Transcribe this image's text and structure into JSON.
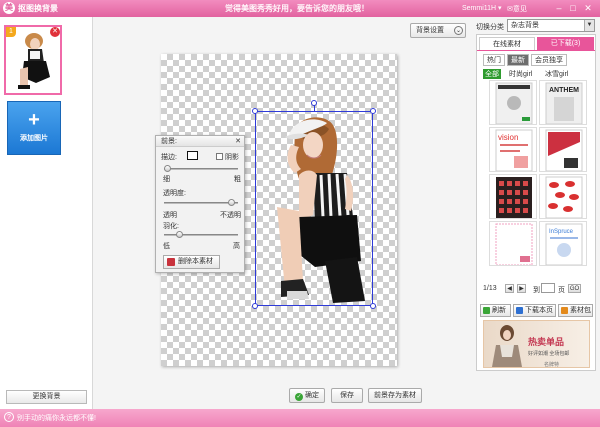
{
  "titlebar": {
    "app_title": "抠图换背景",
    "marquee": "觉得美图秀秀好用，要告诉您的朋友哦！",
    "user": "Semmi11H ▾",
    "feedback": "✉意见",
    "min": "–",
    "max": "□",
    "close": "✕"
  },
  "left": {
    "thumb_badge": "1",
    "thumb_delete": "✕",
    "add_plus": "+",
    "add_label": "添加图片",
    "change_bg": "更换背景"
  },
  "center": {
    "bg_settings": "背景设置",
    "bg_settings_chevron": "⌄"
  },
  "fg_panel": {
    "title": "前景:",
    "close": "✕",
    "edge_label": "描边:",
    "shadow_label": "阴影",
    "edge_min": "细",
    "edge_max": "粗",
    "opacity_label": "透明度:",
    "opacity_min": "透明",
    "opacity_max": "不透明",
    "feather_label": "羽化:",
    "feather_min": "低",
    "feather_max": "高",
    "delete_btn": "删除本素材",
    "edge_value": 0.05,
    "opacity_value": 0.92,
    "feather_value": 0.22
  },
  "bottom": {
    "confirm": "确定",
    "save": "保存",
    "save_as_material": "前景存为素材"
  },
  "right": {
    "switch_label": "切换分类",
    "category": "杂志背景",
    "tabs": [
      {
        "label": "在线素材",
        "active": false
      },
      {
        "label": "已下载(3)",
        "active": true
      }
    ],
    "subtabs": [
      {
        "label": "热门",
        "active": false
      },
      {
        "label": "最新",
        "active": true
      },
      {
        "label": "会员独享",
        "active": false
      }
    ],
    "filters": [
      {
        "label": "全部",
        "active": true
      },
      {
        "label": "时尚girl",
        "active": false
      },
      {
        "label": "冰雪girl",
        "active": false
      }
    ],
    "magazine_title_2": "ANTHEM",
    "magazine_title_3": "vision",
    "magazine_title_8": "InSpruce",
    "pager": {
      "current": "1/13",
      "prev": "◀",
      "next": "▶",
      "go_label": "到",
      "page_unit": "页",
      "go_btn": "GO"
    },
    "refresh": "刷新",
    "download_page": "下载本页",
    "material_pack": "素材包",
    "banner": {
      "title": "热卖单品",
      "subtitle": "好评如潮 全场包邮",
      "sub2": "名牌特"
    }
  },
  "status": {
    "icon": "?",
    "text": "别手动的痛你永远都不懂!"
  },
  "colors": {
    "brand_pink": "#e2629f",
    "selection_blue": "#2f3bd8",
    "add_blue": "#1c78d4"
  }
}
